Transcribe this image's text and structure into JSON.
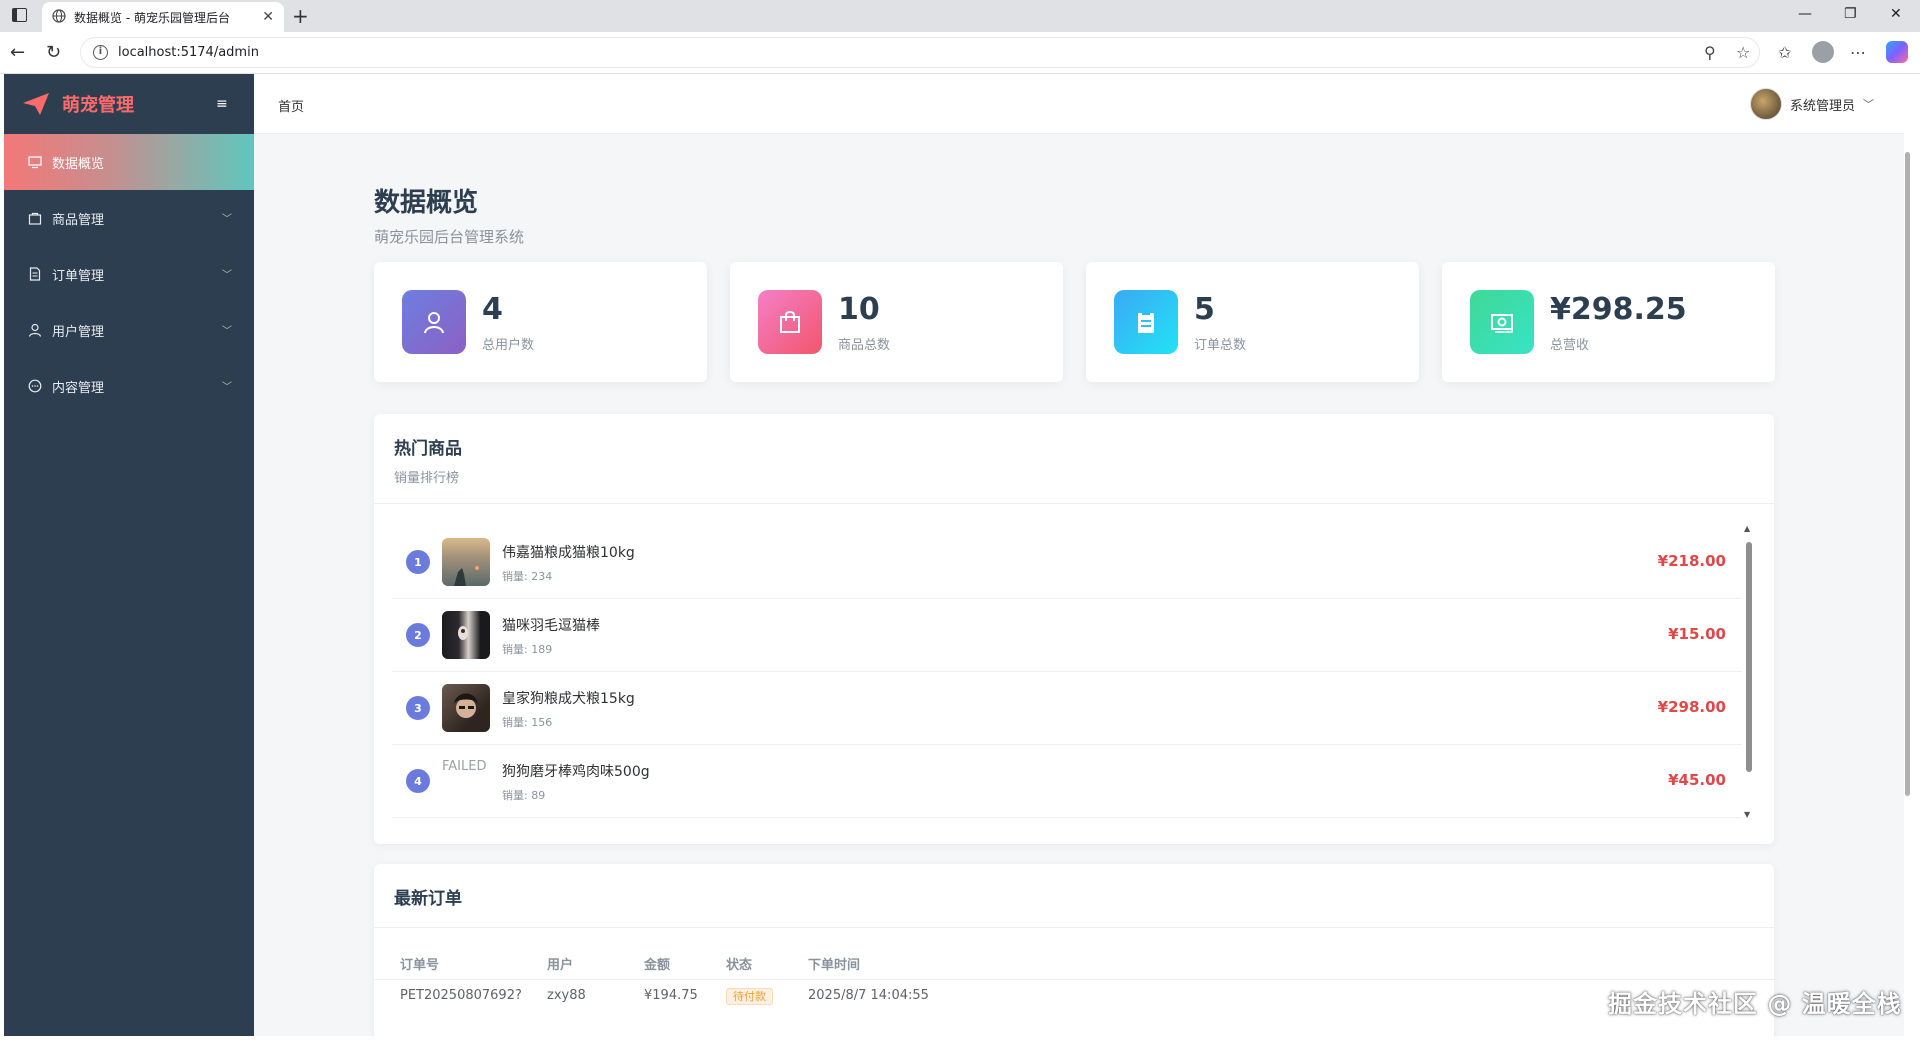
{
  "browser": {
    "tab_title": "数据概览 - 萌宠乐园管理后台",
    "url": "localhost:5174/admin"
  },
  "sidebar": {
    "brand": "萌宠管理",
    "items": [
      {
        "label": "数据概览",
        "icon": "chart-icon",
        "active": true
      },
      {
        "label": "商品管理",
        "icon": "bag-icon"
      },
      {
        "label": "订单管理",
        "icon": "document-icon"
      },
      {
        "label": "用户管理",
        "icon": "user-icon"
      },
      {
        "label": "内容管理",
        "icon": "chat-icon"
      }
    ]
  },
  "header": {
    "breadcrumb": "首页",
    "user_name": "系统管理员"
  },
  "page": {
    "title": "数据概览",
    "subtitle": "萌宠乐园后台管理系统"
  },
  "stats": [
    {
      "value": "4",
      "label": "总用户数",
      "icon": "user-icon",
      "color": "#7b6fd6"
    },
    {
      "value": "10",
      "label": "商品总数",
      "icon": "bag-icon",
      "color": "#f06b9a"
    },
    {
      "value": "5",
      "label": "订单总数",
      "icon": "clipboard-icon",
      "color": "#21c4f0"
    },
    {
      "value": "¥298.25",
      "label": "总营收",
      "icon": "money-icon",
      "color": "#2ed9a0"
    }
  ],
  "hot": {
    "title": "热门商品",
    "subtitle": "销量排行榜",
    "items": [
      {
        "rank": "1",
        "name": "伟嘉猫粮成猫粮10kg",
        "sales": "销量: 234",
        "price": "¥218.00"
      },
      {
        "rank": "2",
        "name": "猫咪羽毛逗猫棒",
        "sales": "销量: 189",
        "price": "¥15.00"
      },
      {
        "rank": "3",
        "name": "皇家狗粮成犬粮15kg",
        "sales": "销量: 156",
        "price": "¥298.00"
      },
      {
        "rank": "4",
        "name": "狗狗磨牙棒鸡肉味500g",
        "sales": "销量: 89",
        "price": "¥45.00",
        "image_text": "FAILED"
      }
    ]
  },
  "orders": {
    "title": "最新订单",
    "columns": [
      "订单号",
      "用户",
      "金额",
      "状态",
      "下单时间"
    ],
    "rows": [
      {
        "no": "PET20250807692?",
        "user": "zxy88",
        "amount": "¥194.75",
        "status": "待付款",
        "time": "2025/8/7 14:04:55"
      }
    ]
  },
  "watermark": "掘金技术社区 @ 温暖全栈"
}
